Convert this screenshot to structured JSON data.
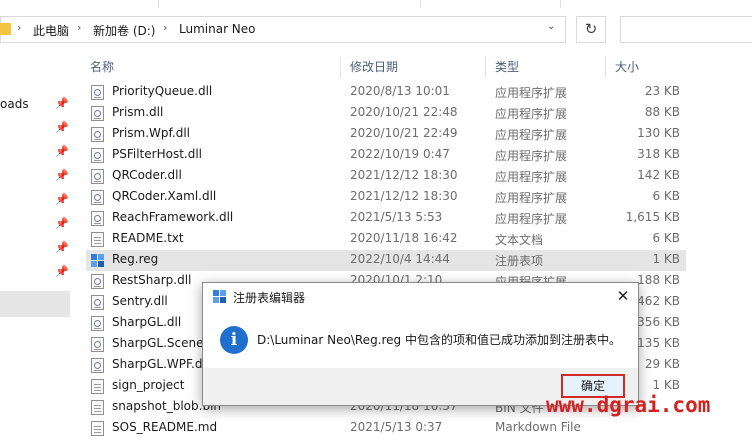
{
  "top_strip": {
    "cut_labels": [
      "",
      "",
      ""
    ]
  },
  "breadcrumb": {
    "items": [
      "此电脑",
      "新加卷 (D:)",
      "Luminar Neo"
    ],
    "separator": "›",
    "dropdown": "⌄",
    "refresh": "↻"
  },
  "nav": {
    "items": [
      {
        "label": "oads"
      },
      {
        "label": ""
      },
      {
        "label": ""
      },
      {
        "label": ""
      },
      {
        "label": ""
      },
      {
        "label": ""
      },
      {
        "label": ""
      },
      {
        "label": ""
      }
    ],
    "pin_glyph": "📌"
  },
  "columns": {
    "name": "名称",
    "date": "修改日期",
    "type": "类型",
    "size": "大小"
  },
  "files": [
    {
      "name": "PriorityQueue.dll",
      "date": "2020/8/13 10:01",
      "type": "应用程序扩展",
      "size": "23 KB",
      "icon": "dll-icon"
    },
    {
      "name": "Prism.dll",
      "date": "2020/10/21 22:48",
      "type": "应用程序扩展",
      "size": "88 KB",
      "icon": "dll-icon"
    },
    {
      "name": "Prism.Wpf.dll",
      "date": "2020/10/21 22:49",
      "type": "应用程序扩展",
      "size": "130 KB",
      "icon": "dll-icon"
    },
    {
      "name": "PSFilterHost.dll",
      "date": "2022/10/19 0:47",
      "type": "应用程序扩展",
      "size": "318 KB",
      "icon": "dll-icon"
    },
    {
      "name": "QRCoder.dll",
      "date": "2021/12/12 18:30",
      "type": "应用程序扩展",
      "size": "142 KB",
      "icon": "dll-icon"
    },
    {
      "name": "QRCoder.Xaml.dll",
      "date": "2021/12/12 18:30",
      "type": "应用程序扩展",
      "size": "6 KB",
      "icon": "dll-icon"
    },
    {
      "name": "ReachFramework.dll",
      "date": "2021/5/13 5:53",
      "type": "应用程序扩展",
      "size": "1,615 KB",
      "icon": "dll-icon"
    },
    {
      "name": "README.txt",
      "date": "2020/11/18 16:42",
      "type": "文本文档",
      "size": "6 KB",
      "icon": "text-file-icon"
    },
    {
      "name": "Reg.reg",
      "date": "2022/10/4 14:44",
      "type": "注册表项",
      "size": "1 KB",
      "icon": "registry-file-icon",
      "selected": true
    },
    {
      "name": "RestSharp.dll",
      "date": "2020/10/1 2:10",
      "type": "应用程序扩展",
      "size": "188 KB",
      "icon": "dll-icon"
    },
    {
      "name": "Sentry.dll",
      "date": "",
      "type": "",
      "size": "462 KB",
      "icon": "dll-icon"
    },
    {
      "name": "SharpGL.dll",
      "date": "",
      "type": "",
      "size": "356 KB",
      "icon": "dll-icon"
    },
    {
      "name": "SharpGL.SceneG",
      "date": "",
      "type": "",
      "size": "135 KB",
      "icon": "dll-icon"
    },
    {
      "name": "SharpGL.WPF.dl",
      "date": "",
      "type": "",
      "size": "29 KB",
      "icon": "dll-icon"
    },
    {
      "name": "sign_project",
      "date": "",
      "type": "",
      "size": "1 KB",
      "icon": "file-icon"
    },
    {
      "name": "snapshot_blob.bin",
      "date": "2020/11/18 16:37",
      "type": "BIN 文件",
      "size": "",
      "icon": "file-icon"
    },
    {
      "name": "SOS_README.md",
      "date": "2021/5/13 0:37",
      "type": "Markdown File",
      "size": "",
      "icon": "file-icon"
    }
  ],
  "dialog": {
    "title": "注册表编辑器",
    "close": "✕",
    "info_glyph": "i",
    "message": "D:\\Luminar Neo\\Reg.reg 中包含的项和值已成功添加到注册表中。",
    "ok_label": "确定"
  },
  "watermark": "www.dgrai.com",
  "colors": {
    "accent": "#1f6fcf",
    "highlight_border": "#d12a2a",
    "selection": "#e5e5e5",
    "watermark": "#d32222"
  }
}
